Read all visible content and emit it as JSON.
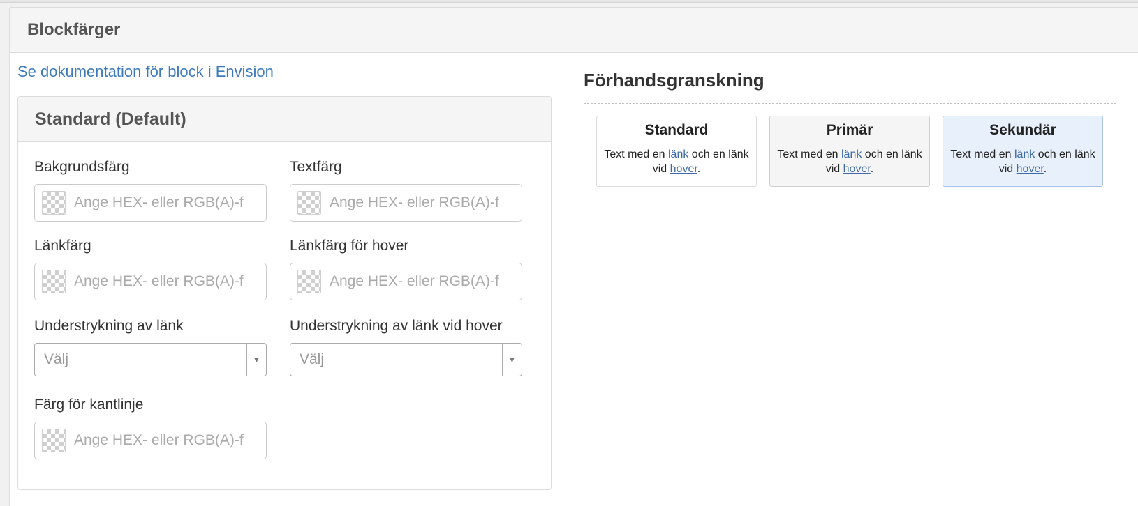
{
  "panel": {
    "title": "Blockfärger"
  },
  "doc_link": "Se dokumentation för block i Envision",
  "standard_section": {
    "title": "Standard (Default)",
    "fields": {
      "background_color": {
        "label": "Bakgrundsfärg",
        "placeholder": "Ange HEX- eller RGB(A)-f"
      },
      "text_color": {
        "label": "Textfärg",
        "placeholder": "Ange HEX- eller RGB(A)-f"
      },
      "link_color": {
        "label": "Länkfärg",
        "placeholder": "Ange HEX- eller RGB(A)-f"
      },
      "link_hover_color": {
        "label": "Länkfärg för hover",
        "placeholder": "Ange HEX- eller RGB(A)-f"
      },
      "link_underline": {
        "label": "Understrykning av länk",
        "value": "Välj"
      },
      "link_hover_underline": {
        "label": "Understrykning av länk vid hover",
        "value": "Välj"
      },
      "border_color": {
        "label": "Färg för kantlinje",
        "placeholder": "Ange HEX- eller RGB(A)-f"
      }
    }
  },
  "preview": {
    "title": "Förhandsgranskning",
    "text_before": "Text med en ",
    "link_word": "länk",
    "text_middle": " och en länk vid ",
    "hover_word": "hover",
    "text_end": ".",
    "cards": [
      {
        "title": "Standard"
      },
      {
        "title": "Primär"
      },
      {
        "title": "Sekundär"
      }
    ]
  }
}
